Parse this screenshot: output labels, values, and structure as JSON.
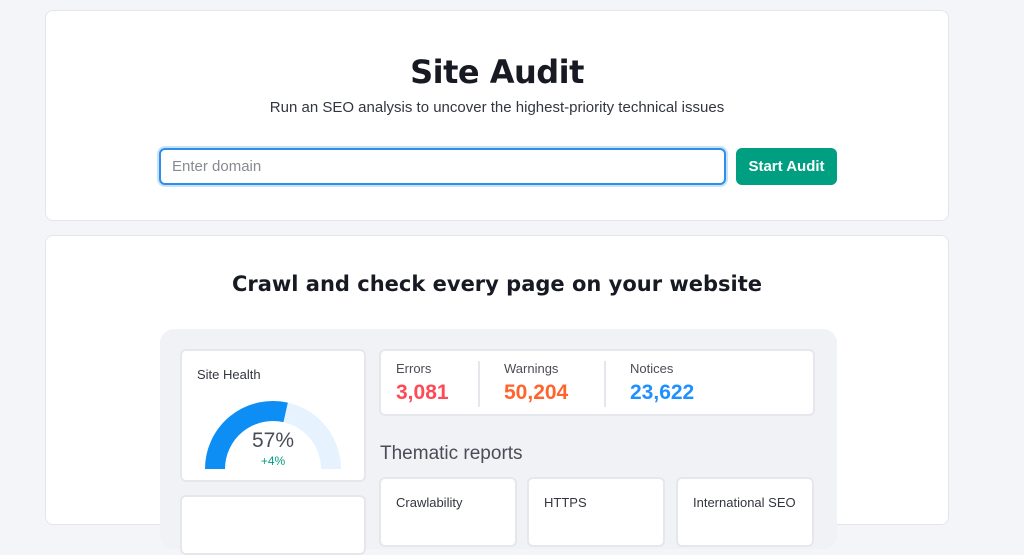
{
  "hero": {
    "title": "Site Audit",
    "subtitle": "Run an SEO analysis to uncover the highest-priority technical issues",
    "domain_placeholder": "Enter domain",
    "domain_value": "",
    "start_button": "Start Audit"
  },
  "feature": {
    "title": "Crawl and check every page on your website",
    "site_health": {
      "label": "Site Health",
      "value": "57%",
      "value_fraction": 0.57,
      "delta": "+4%"
    },
    "stats": [
      {
        "label": "Errors",
        "value": "3,081",
        "color": "#ff4953"
      },
      {
        "label": "Warnings",
        "value": "50,204",
        "color": "#ff642d"
      },
      {
        "label": "Notices",
        "value": "23,622",
        "color": "#1e90ff"
      }
    ],
    "thematic_title": "Thematic reports",
    "reports": [
      "Crawlability",
      "HTTPS",
      "International SEO"
    ]
  },
  "colors": {
    "accent_green": "#009f81",
    "gauge_blue": "#0c8ef5",
    "gauge_track": "#e6f3ff",
    "input_focus": "#2e8fe8"
  }
}
